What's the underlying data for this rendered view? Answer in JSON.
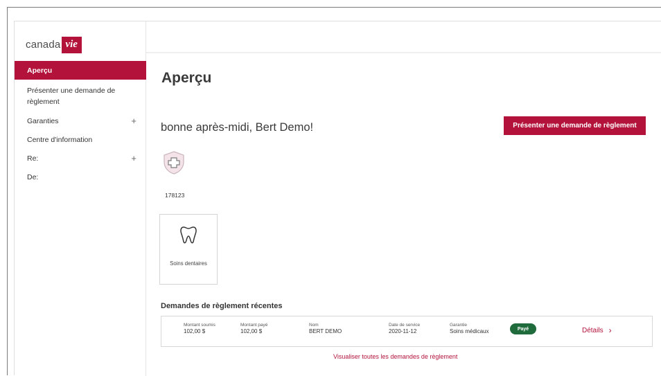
{
  "logo": {
    "text": "canada",
    "badge": "vie"
  },
  "sidebar": {
    "items": [
      {
        "label": "Aperçu",
        "active": true,
        "expandable": false
      },
      {
        "label": "Présenter une demande de règlement",
        "active": false,
        "expandable": false
      },
      {
        "label": "Garanties",
        "active": false,
        "expandable": true
      },
      {
        "label": "Centre d'information",
        "active": false,
        "expandable": false
      },
      {
        "label": "Re:",
        "active": false,
        "expandable": true
      },
      {
        "label": "De:",
        "active": false,
        "expandable": false
      }
    ],
    "expand_icon": "+"
  },
  "main": {
    "title": "Aperçu",
    "greeting": "bonne après-midi, Bert Demo!",
    "claim_button": "Présenter une demande de règlement",
    "member_id": "178123",
    "benefit_card": {
      "label": "Soins dentaires",
      "icon": "tooth-icon"
    },
    "recent_claims_title": "Demandes de règlement récentes",
    "claims": [
      {
        "submitted_label": "Montant soumis",
        "submitted": "102,00 $",
        "paid_label": "Montant payé",
        "paid": "102,00 $",
        "name_label": "Nom",
        "name": "BERT DEMO",
        "date_label": "Date de service",
        "date": "2020-11-12",
        "benefit_label": "Garantie",
        "benefit": "Soins médicaux",
        "status": "Payé",
        "details": "Détails",
        "details_icon": "›"
      }
    ],
    "see_all": "Visualiser toutes les demandes de règlement"
  },
  "colors": {
    "brand": "#b3123a",
    "paid": "#1f6b3c"
  }
}
